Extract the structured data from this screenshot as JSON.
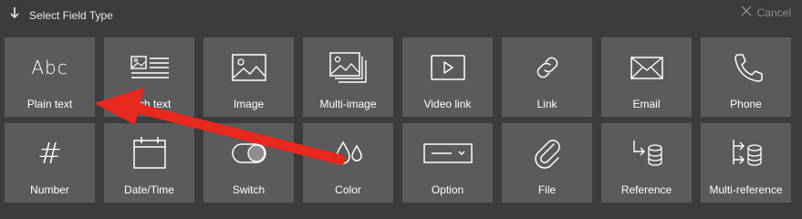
{
  "header": {
    "title": "Select Field Type",
    "cancel_label": "Cancel"
  },
  "tiles": [
    {
      "label": "Plain text",
      "icon": "abc-icon",
      "glyph": "Abc"
    },
    {
      "label": "ch text",
      "icon": "rich-text-icon"
    },
    {
      "label": "Image",
      "icon": "image-icon"
    },
    {
      "label": "Multi-image",
      "icon": "multi-image-icon"
    },
    {
      "label": "Video link",
      "icon": "video-link-icon"
    },
    {
      "label": "Link",
      "icon": "link-icon"
    },
    {
      "label": "Email",
      "icon": "email-icon"
    },
    {
      "label": "Phone",
      "icon": "phone-icon"
    },
    {
      "label": "Number",
      "icon": "hash-icon",
      "glyph": "#"
    },
    {
      "label": "Date/Time",
      "icon": "calendar-icon"
    },
    {
      "label": "Switch",
      "icon": "toggle-icon"
    },
    {
      "label": "Color",
      "icon": "droplets-icon"
    },
    {
      "label": "Option",
      "icon": "select-dropdown-icon"
    },
    {
      "label": "File",
      "icon": "paperclip-icon"
    },
    {
      "label": "Reference",
      "icon": "reference-icon"
    },
    {
      "label": "Multi-reference",
      "icon": "multi-reference-icon"
    }
  ],
  "colors": {
    "background": "#3c3b3e",
    "tile": "#5b5a5d",
    "annotation_arrow": "#e8291f"
  }
}
